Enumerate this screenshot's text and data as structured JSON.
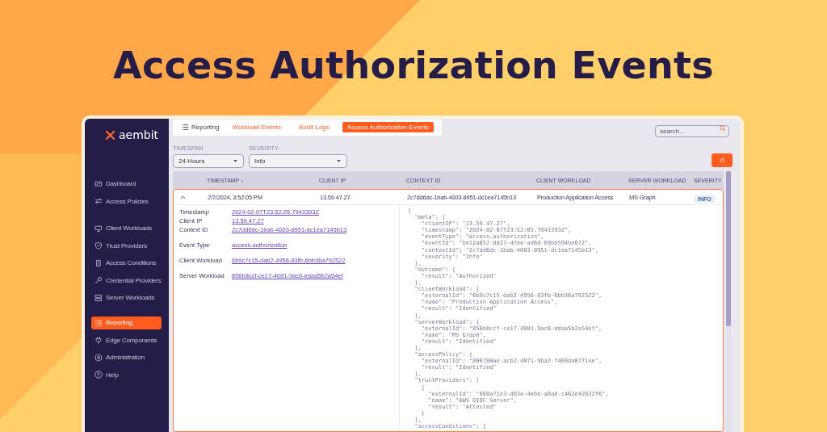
{
  "headline": "Access Authorization Events",
  "logo": {
    "text": "aembit"
  },
  "sidebar": {
    "sections": [
      [
        {
          "label": "Dashboard",
          "selected": false
        },
        {
          "label": "Access Policies",
          "selected": false
        }
      ],
      [
        {
          "label": "Client Workloads",
          "selected": false
        },
        {
          "label": "Trust Providers",
          "selected": false
        },
        {
          "label": "Access Conditions",
          "selected": false
        },
        {
          "label": "Credential Providers",
          "selected": false
        },
        {
          "label": "Server Workloads",
          "selected": false
        }
      ],
      [
        {
          "label": "Reporting",
          "selected": true
        },
        {
          "label": "Edge Components",
          "selected": false
        },
        {
          "label": "Administration",
          "selected": false
        },
        {
          "label": "Help",
          "selected": false
        }
      ]
    ]
  },
  "tabs": [
    {
      "label": "Reporting",
      "kind": "title"
    },
    {
      "label": "Workload Events",
      "kind": "tab",
      "selected": false
    },
    {
      "label": "Audit Logs",
      "kind": "tab",
      "selected": false
    },
    {
      "label": "Access Authorization Events",
      "kind": "tab",
      "selected": true
    }
  ],
  "search": {
    "placeholder": "search..."
  },
  "filters": [
    {
      "label": "TIMESPAN",
      "value": "24 Hours"
    },
    {
      "label": "SEVERITY",
      "value": "Info"
    }
  ],
  "table": {
    "columns": [
      "TIMESTAMP ↓",
      "CLIENT IP",
      "CONTEXT ID",
      "CLIENT WORKLOAD",
      "SERVER WORKLOAD",
      "SEVERITY"
    ],
    "rows": [
      {
        "expanded": true,
        "cells": [
          "2/7/2024, 3:52:05 PM",
          "13.59.47.27",
          "2c7dd6dc-1bab-4003-8951-dc1ea7145b13",
          "Production Application Access",
          "MS Graph"
        ],
        "severity": "INFO"
      }
    ]
  },
  "details": {
    "groups": [
      [
        {
          "label": "Timestamp",
          "value": "2024-02-07T23:52:05.7943393Z"
        },
        {
          "label": "Client IP",
          "value": "13.59.47.27"
        },
        {
          "label": "Context ID",
          "value": "2c7dd6dc-1bab-4003-8951-dc1ea7145b13"
        }
      ],
      [
        {
          "label": "Event Type",
          "value": "access.authorization"
        }
      ],
      [
        {
          "label": "Client Workload",
          "value": "6b9c7c15-dab2-4956-83fb-6bb36a792522"
        }
      ],
      [
        {
          "label": "Server Workload",
          "value": "856b8ccf-ce17-4081-9ac0-edaa5b2a54ef"
        }
      ]
    ],
    "json_lines": [
      "{",
      "  \"meta\": {",
      "    \"clientIP\": \"13.59.47.27\",",
      "    \"timestamp\": \"2024-02-07T23:52:05.7943393Z\",",
      "    \"eventType\": \"access.authorization\",",
      "    \"eventId\": \"be12a657-8d27-4fee-ad6d-69bb594be672\",",
      "    \"contextId\": \"2c7dd6dc-1bab-4003-8951-dc1ea7145b13\",",
      "    \"severity\": \"Info\"",
      "  },",
      "  \"outcome\": {",
      "    \"result\": \"Authorized\"",
      "  },",
      "  \"clientWorkload\": {",
      "    \"externalId\": \"6b9c7c15-dab2-4956-83fb-6bb36a792522\",",
      "    \"name\": \"Production Application Access\",",
      "    \"result\": \"Identified\"",
      "  },",
      "  \"serverWorkload\": {",
      "    \"externalId\": \"856b8ccf-ce17-4081-9ac0-edaa5b2a54ef\",",
      "    \"name\": \"MS Graph\",",
      "    \"result\": \"Identified\"",
      "  },",
      "  \"accessPolicy\": {",
      "    \"externalId\": \"806780ae-acb2-4071-9ba2-f469da07714e\",",
      "    \"result\": \"Identified\"",
      "  },",
      "  \"trustProviders\": [",
      "    {",
      "      \"externalId\": \"660a71e3-d83e-4ebb-a0a8-c462e42632f6\",",
      "      \"name\": \"AWS OIDC Server\",",
      "      \"result\": \"Attested\"",
      "    }",
      "  ],",
      "  \"accessConditions\": ["
    ]
  }
}
